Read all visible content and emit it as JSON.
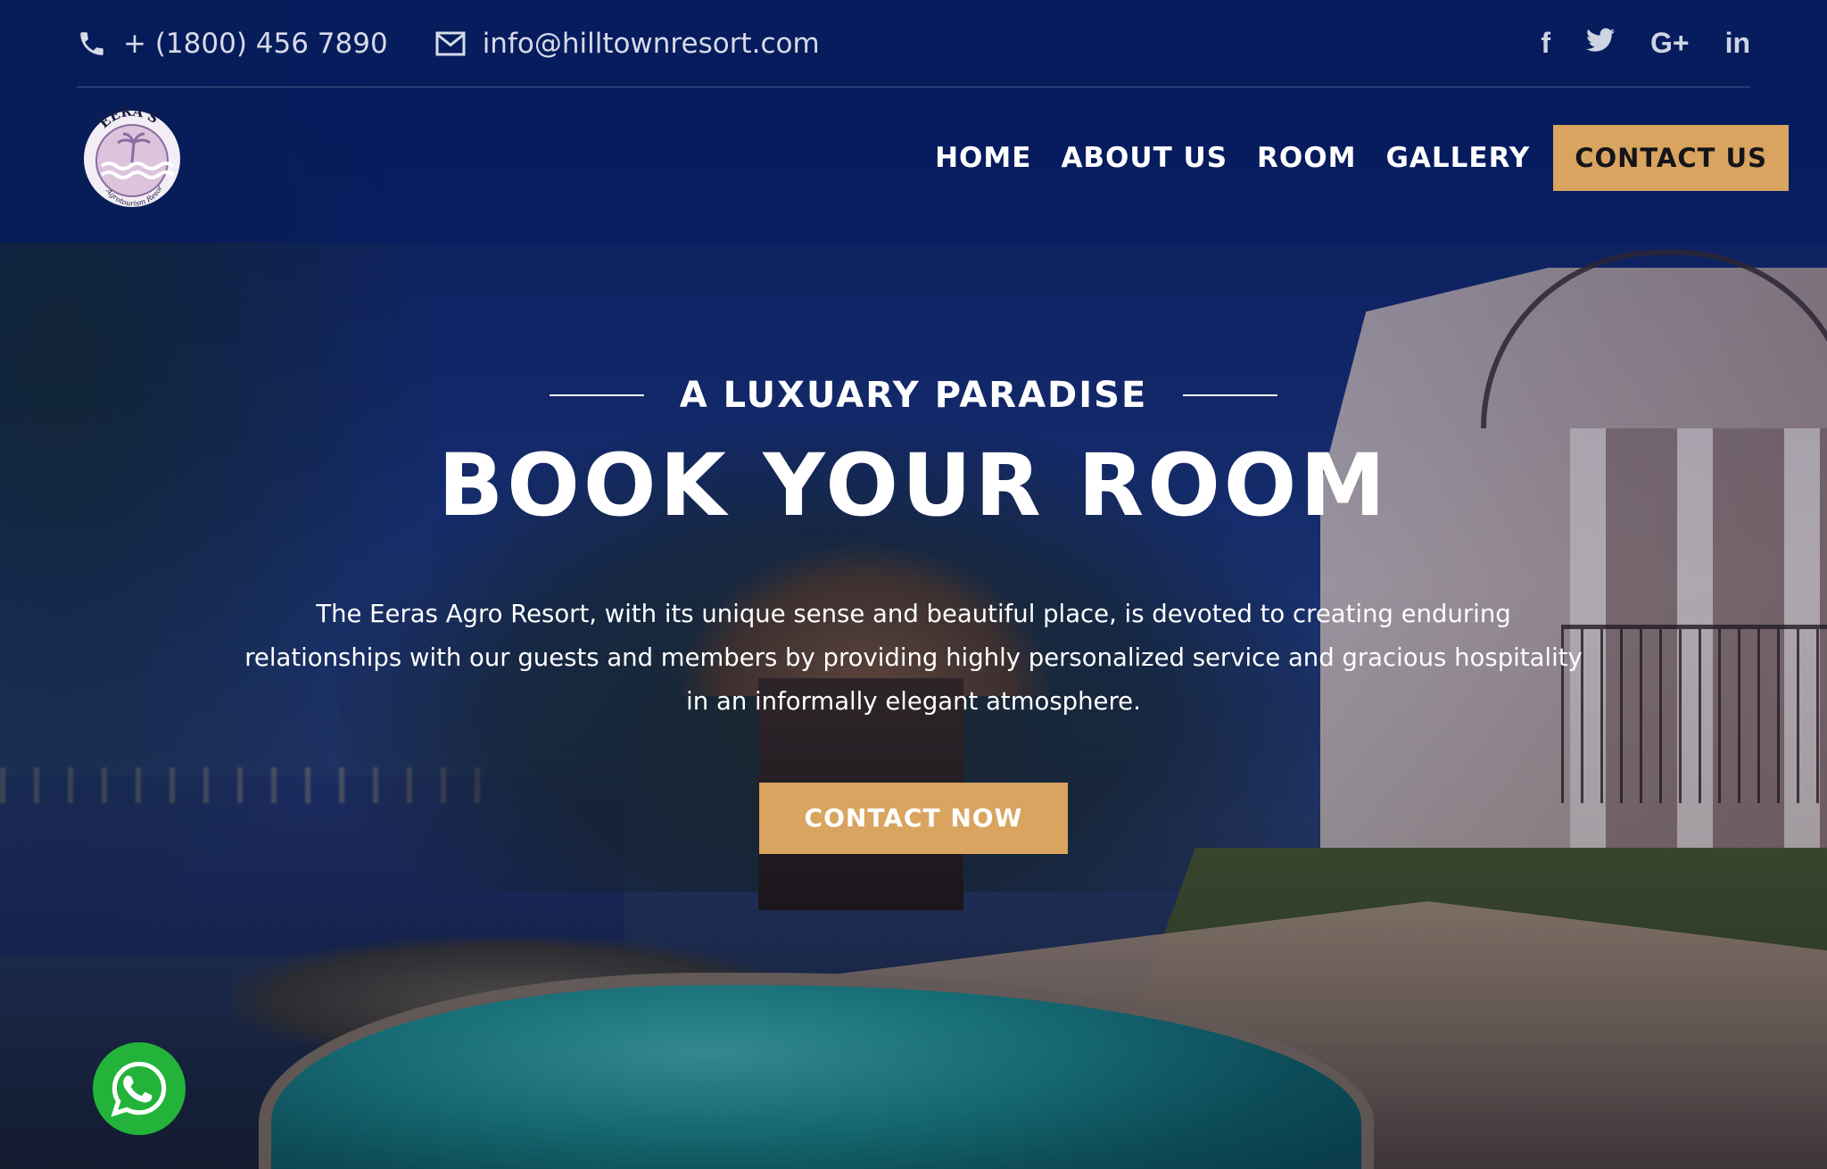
{
  "topbar": {
    "phone": "+ (1800) 456 7890",
    "email": "info@hilltownresort.com",
    "socials": [
      {
        "icon": "facebook-icon",
        "label": "f"
      },
      {
        "icon": "twitter-icon",
        "label": "t"
      },
      {
        "icon": "google-plus-icon",
        "label": "G+"
      },
      {
        "icon": "linkedin-icon",
        "label": "in"
      }
    ]
  },
  "logo": {
    "arc_text": "EERA'S",
    "sub_text": "Agrotourism Resort"
  },
  "nav": {
    "items": [
      "HOME",
      "ABOUT US",
      "ROOM",
      "GALLERY"
    ],
    "cta": "CONTACT US"
  },
  "hero": {
    "eyebrow": "A LUXUARY PARADISE",
    "headline": "BOOK YOUR ROOM",
    "lead": "The Eeras Agro Resort, with its unique sense and beautiful place, is devoted to creating enduring relationships with our guests and members by providing highly personalized service and gracious hospitality in an informally elegant atmosphere.",
    "cta": "CONTACT NOW"
  },
  "colors": {
    "header_bg": "#051c5f",
    "accent": "#d9a460",
    "whatsapp": "#23b33a"
  },
  "floating": {
    "icon": "whatsapp-icon"
  }
}
